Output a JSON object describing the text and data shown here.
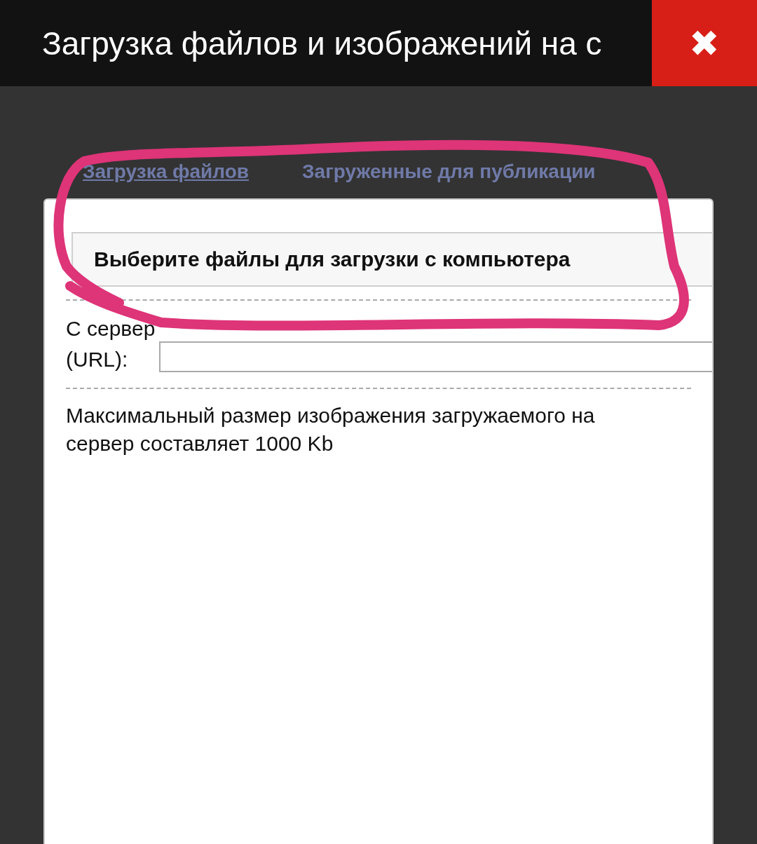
{
  "window": {
    "title": "Загрузка файлов и изображений на с",
    "close_label": "✖"
  },
  "tabs": [
    {
      "label": "Загрузка файлов",
      "selected": true
    },
    {
      "label": "Загруженные для публикации",
      "selected": false
    }
  ],
  "file_button": {
    "label": "Выберите файлы для загрузки с компьютера"
  },
  "url": {
    "label_line1": "С сервер",
    "label_line2": "(URL):"
  },
  "note": "Максимальный размер изображения загружаемого на сервер составляет 1000 Kb"
}
